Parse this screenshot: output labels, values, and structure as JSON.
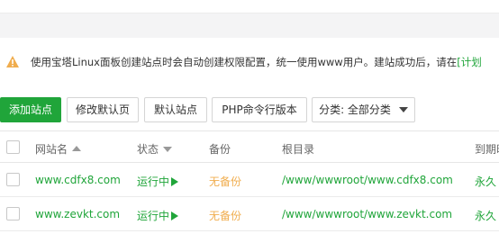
{
  "notice": {
    "text": "使用宝塔Linux面板创建站点时会自动创建权限配置，统一使用www用户。建站成功后，请在",
    "link": "[计划"
  },
  "toolbar": {
    "add_site": "添加站点",
    "edit_default_page": "修改默认页",
    "default_site": "默认站点",
    "php_version": "PHP命令行版本",
    "category_select": "分类: 全部分类"
  },
  "table": {
    "headers": {
      "site_name": "网站名",
      "status": "状态",
      "backup": "备份",
      "root_dir": "根目录",
      "expire": "到期时"
    },
    "rows": [
      {
        "name": "www.cdfx8.com",
        "status": "运行中",
        "backup": "无备份",
        "root": "/www/wwwroot/www.cdfx8.com",
        "expire": "永久"
      },
      {
        "name": "www.zevkt.com",
        "status": "运行中",
        "backup": "无备份",
        "root": "/www/wwwroot/www.zevkt.com",
        "expire": "永久"
      }
    ]
  },
  "colors": {
    "accent": "#20a53a",
    "warning": "#f0ad4e"
  }
}
